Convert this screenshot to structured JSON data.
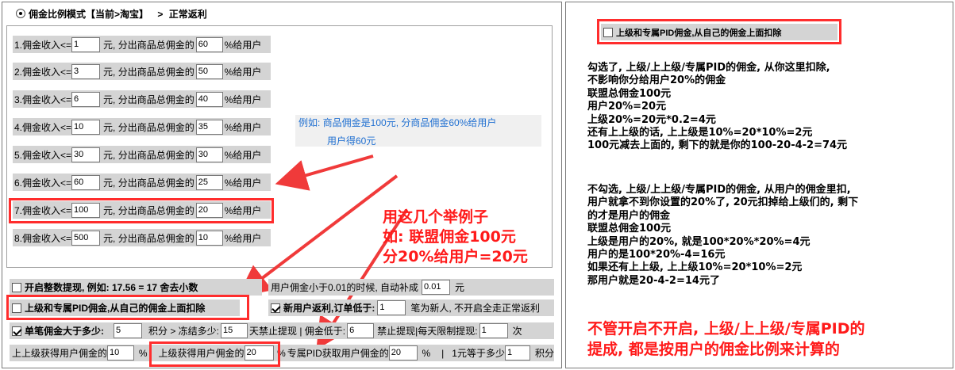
{
  "header": {
    "radio_label": "佣金比例模式【当前>淘宝】",
    "arrow": ">",
    "mode": "正常返利"
  },
  "tiers": [
    {
      "label": "1.佣金收入<=",
      "amount": "1",
      "mid": "元, 分出商品总佣金的",
      "percent": "60",
      "suffix": "%给用户"
    },
    {
      "label": "2.佣金收入<=",
      "amount": "3",
      "mid": "元, 分出商品总佣金的",
      "percent": "50",
      "suffix": "%给用户"
    },
    {
      "label": "3.佣金收入<=",
      "amount": "6",
      "mid": "元, 分出商品总佣金的",
      "percent": "40",
      "suffix": "%给用户"
    },
    {
      "label": "4.佣金收入<=",
      "amount": "10",
      "mid": "元, 分出商品总佣金的",
      "percent": "35",
      "suffix": "%给用户"
    },
    {
      "label": "5.佣金收入<=",
      "amount": "30",
      "mid": "元, 分出商品总佣金的",
      "percent": "30",
      "suffix": "%给用户"
    },
    {
      "label": "6.佣金收入<=",
      "amount": "60",
      "mid": "元, 分出商品总佣金的",
      "percent": "25",
      "suffix": "%给用户"
    },
    {
      "label": "7.佣金收入<=",
      "amount": "100",
      "mid": "元, 分出商品总佣金的",
      "percent": "20",
      "suffix": "%给用户"
    },
    {
      "label": "8.佣金收入<=",
      "amount": "500",
      "mid": "元, 分出商品总佣金的",
      "percent": "10",
      "suffix": "%给用户"
    }
  ],
  "example": {
    "line1": "例如: 商品佣金是100元, 分商品佣金60%给用户",
    "line2": "用户得60元"
  },
  "annotation_left": {
    "line1": "用这几个举例子",
    "line2": "如: 联盟佣金100元",
    "line3": "分20%给用户=20元"
  },
  "options": {
    "integer_withdraw": "开启整数提现, 例如: 17.56 = 17 舍去小数",
    "min_commission_label": "用户佣金小于0.01的时候, 自动补成",
    "min_commission_value": "0.01",
    "min_commission_unit": "元",
    "parent_deduct": "上级和专属PID佣金,从自己的佣金上面扣除",
    "new_user_label": "新用户返利,订单低于:",
    "new_user_value": "1",
    "new_user_note": "笔为新人, 不开启全走正常返利",
    "single_label": "单笔佣金大于多少:",
    "single_value": "5",
    "points_freeze": "积分 > 冻结多少:",
    "freeze_value": "15",
    "freeze_note": "天禁止提现 | 佣金低于:",
    "min_value": "6",
    "daily_note": "禁止提现|每天限制提现:",
    "daily_value": "1",
    "daily_unit": "次",
    "grand_label": "上上级获得用户佣金的",
    "grand_value": "10",
    "grand_unit": "%",
    "parent_label": "上级获得用户佣金的",
    "parent_value": "20",
    "parent_unit": "%",
    "pid_label": "专属PID获取用户佣金的",
    "pid_value": "20",
    "pid_unit": "%",
    "sep": "|",
    "yuan_label": "1元等于多少",
    "yuan_value": "1",
    "yuan_unit": "积分"
  },
  "right_panel": {
    "checkbox_label": "上级和专属PID佣金,从自己的佣金上面扣除",
    "para1": [
      "勾选了, 上级/上上级/专属PID的佣金, 从你这里扣除,",
      "不影响你分给用户20%的佣金",
      "联盟总佣金100元",
      "用户20%=20元",
      "上级20%=20元*0.2=4元",
      "还有上上级的话, 上上级是10%=20*10%=2元",
      "100元减去上面的, 剩下的就是你的100-20-4-2=74元"
    ],
    "para2": [
      "不勾选, 上级/上上级/专属PID的佣金, 从用户的佣金里扣,",
      "用户就拿不到你设置的20%了, 20元扣掉给上级们的, 剩下",
      "的才是用户的佣金",
      "联盟总佣金100元",
      "上级是用户的20%, 就是100*20%*20%=4元",
      "用户的是100*20%-4=16元",
      "如果还有上上级, 上上级10%=20*10%=2元",
      "那用户就是20-4-2=14元了"
    ],
    "conclusion1": "不管开启不开启, 上级/上上级/专属PID的",
    "conclusion2": "提成, 都是按用户的佣金比例来计算的"
  }
}
